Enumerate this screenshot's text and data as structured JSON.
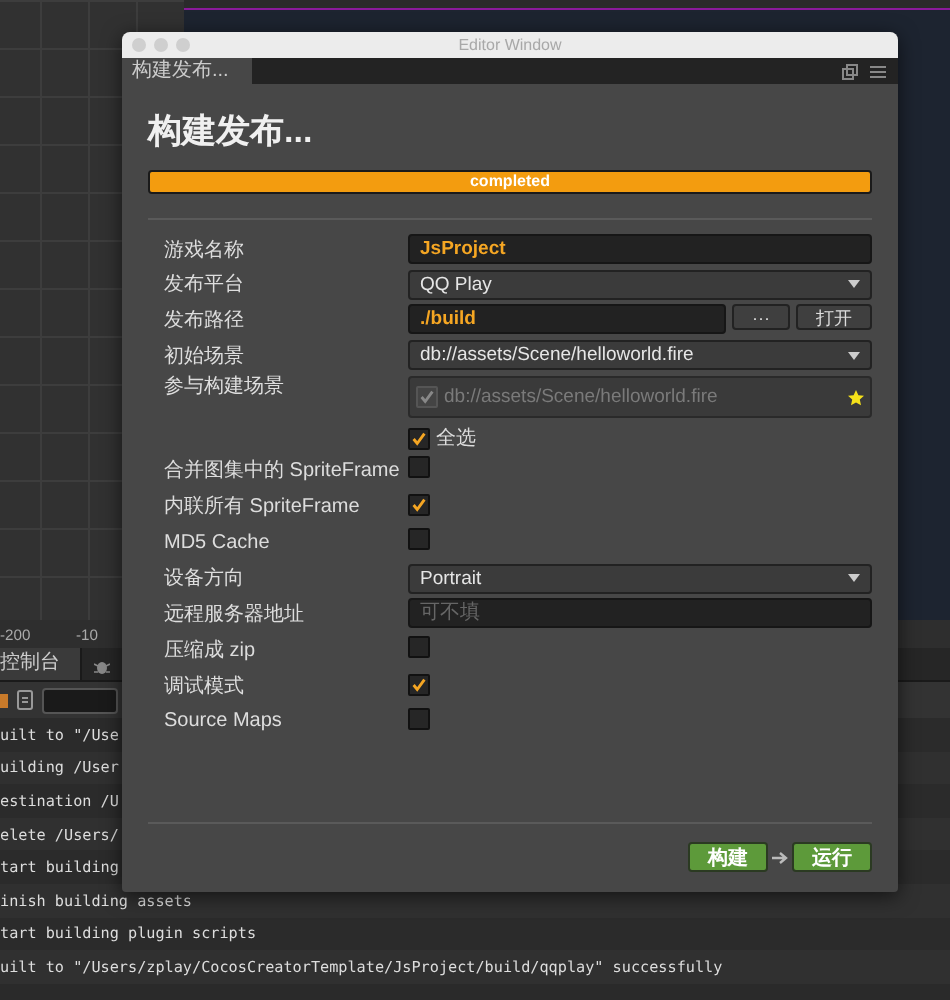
{
  "scene": {
    "axis_labels": [
      "-200",
      "-10"
    ]
  },
  "console": {
    "tabs": [
      {
        "label": "控制台",
        "selected": true
      }
    ],
    "lines": [
      "uilt to \"/Use",
      "uilding /User",
      "estination /U",
      "elete /Users/",
      "tart building",
      "inish building assets",
      "tart building plugin scripts",
      "uilt to \"/Users/zplay/CocosCreatorTemplate/JsProject/build/qqplay\" successfully"
    ]
  },
  "window": {
    "title": "Editor Window",
    "tab": "构建发布...",
    "heading": "构建发布...",
    "progress": {
      "level": 1,
      "label": "completed"
    },
    "fields": [
      {
        "kind": "input",
        "label": "游戏名称",
        "value": "JsProject"
      },
      {
        "kind": "select",
        "label": "发布平台",
        "value": "QQ Play"
      },
      {
        "kind": "path",
        "label": "发布路径",
        "value": "./build",
        "buttons": [
          "···",
          "打开"
        ]
      },
      {
        "kind": "select",
        "label": "初始场景",
        "value": "db://assets/Scene/helloworld.fire"
      },
      {
        "kind": "scenes",
        "label": "参与构建场景",
        "items": [
          {
            "name": "db://assets/Scene/helloworld.fire",
            "checked": true,
            "disabled": true
          }
        ],
        "select_all": {
          "label": "全选",
          "checked": true
        }
      },
      {
        "kind": "checkbox",
        "label": "合并图集中的 SpriteFrame",
        "checked": false
      },
      {
        "kind": "checkbox",
        "label": "内联所有 SpriteFrame",
        "checked": true
      },
      {
        "kind": "checkbox",
        "label": "MD5 Cache",
        "checked": false
      },
      {
        "kind": "select",
        "label": "设备方向",
        "value": "Portrait"
      },
      {
        "kind": "input",
        "label": "远程服务器地址",
        "placeholder": "可不填"
      },
      {
        "kind": "checkbox",
        "label": "压缩成 zip",
        "checked": false
      },
      {
        "kind": "checkbox",
        "label": "调试模式",
        "checked": true
      },
      {
        "kind": "checkbox",
        "label": "Source Maps",
        "checked": false
      }
    ],
    "buttons": [
      {
        "label": "构建"
      },
      {
        "label": "运行"
      }
    ]
  }
}
